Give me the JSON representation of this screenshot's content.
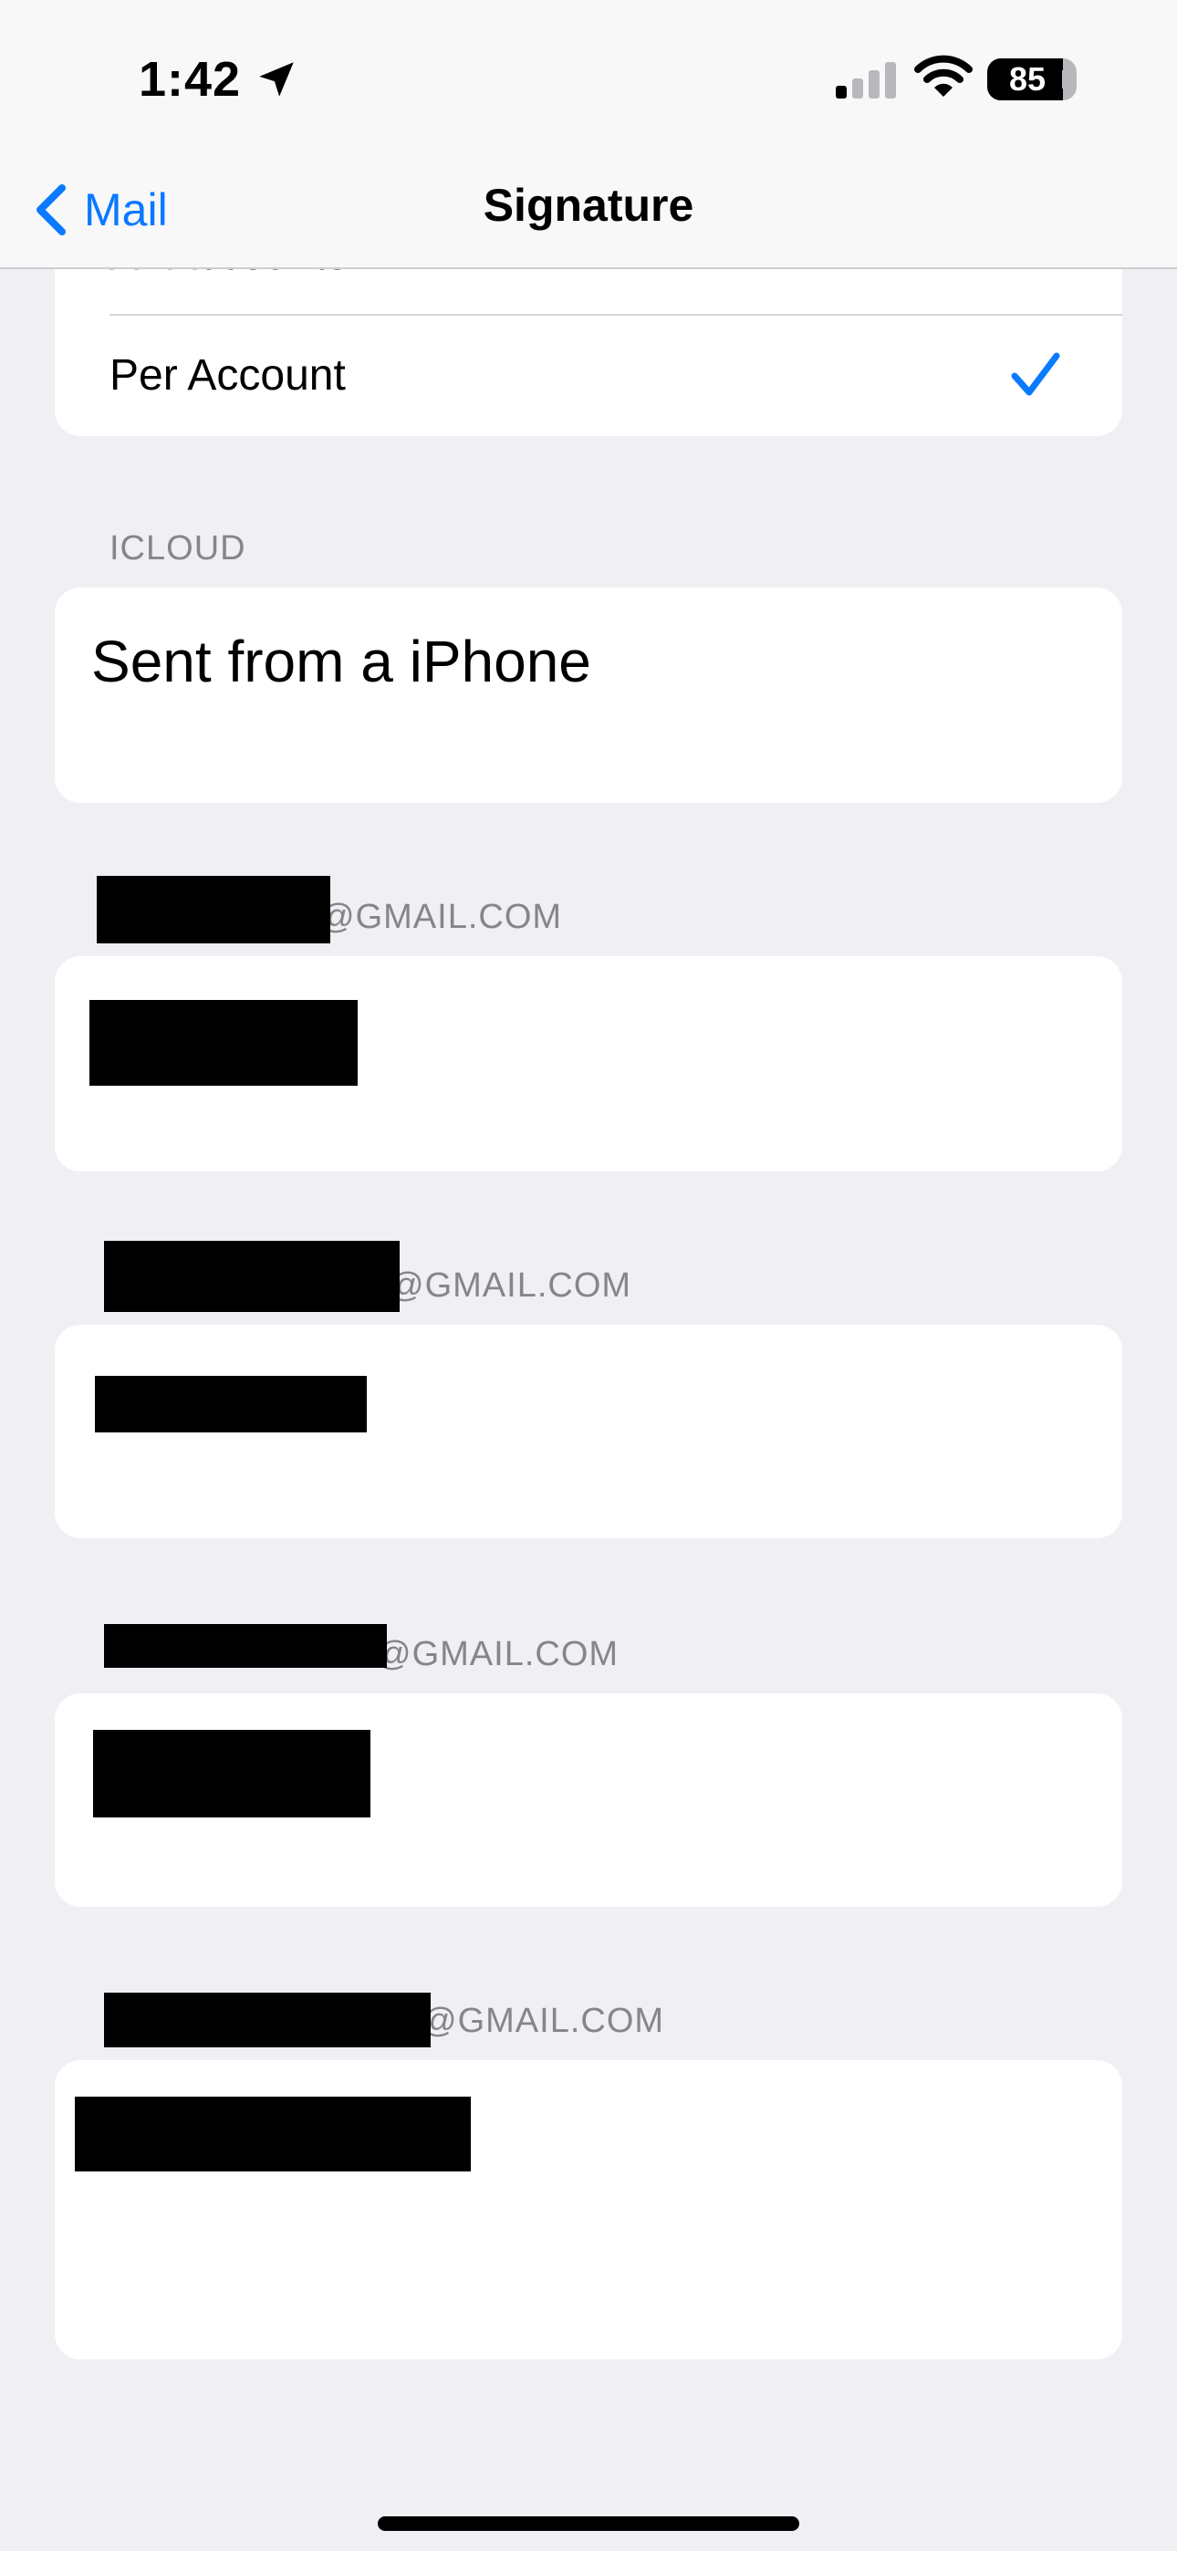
{
  "status_bar": {
    "time": "1:42",
    "battery_level": "85",
    "battery_fraction": 0.85,
    "signal_bars_active": 1,
    "signal_bars_total": 4
  },
  "nav": {
    "back_label": "Mail",
    "title": "Signature"
  },
  "scope_options": {
    "all_accounts_label": "All Accounts",
    "per_account_label": "Per Account",
    "selected": "Per Account"
  },
  "sections": [
    {
      "header": "ICLOUD",
      "signature": "Sent from a iPhone"
    },
    {
      "header": "@GMAIL.COM",
      "signature": ""
    },
    {
      "header": "@GMAIL.COM",
      "signature": ""
    },
    {
      "header": "@GMAIL.COM",
      "signature": ""
    },
    {
      "header": "@GMAIL.COM",
      "signature": ""
    }
  ],
  "colors": {
    "accent": "#0a7aff",
    "background": "#efeff4",
    "secondary_text": "#85858b"
  }
}
